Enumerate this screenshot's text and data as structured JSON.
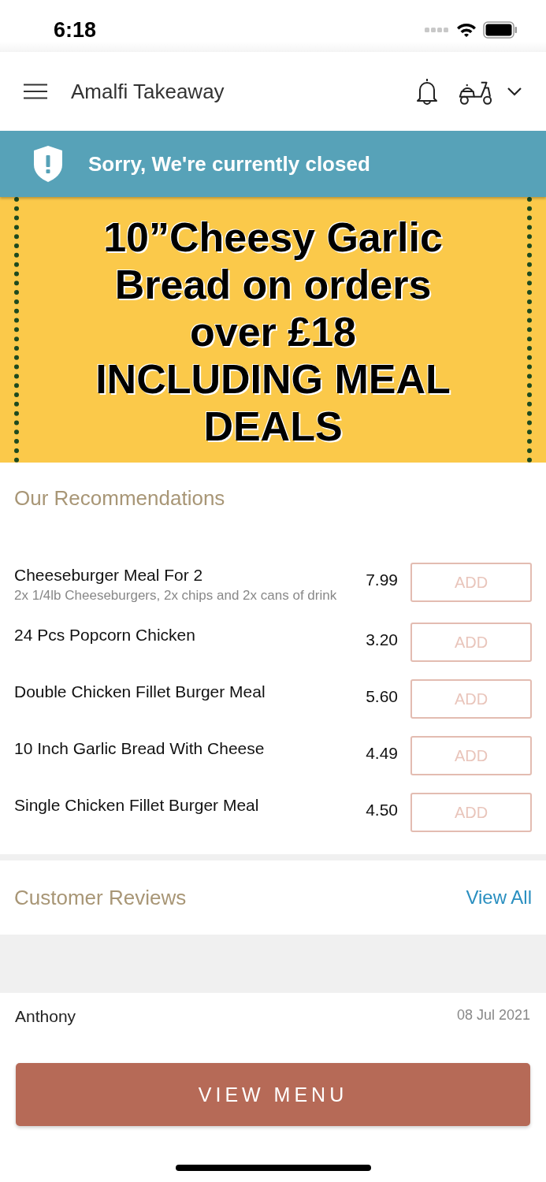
{
  "status_bar": {
    "time": "6:18"
  },
  "header": {
    "title": "Amalfi Takeaway"
  },
  "notice": {
    "text": "Sorry, We're currently closed"
  },
  "promo": {
    "lines": [
      "10”Cheesy Garlic",
      "Bread on orders",
      "over £18",
      "INCLUDING MEAL",
      "DEALS"
    ]
  },
  "recommendations": {
    "title": "Our Recommendations",
    "items": [
      {
        "name": "Cheeseburger Meal For 2",
        "description": "2x 1/4lb Cheeseburgers, 2x chips and 2x cans of drink",
        "price": "7.99",
        "button": "ADD"
      },
      {
        "name": "24 Pcs Popcorn Chicken",
        "price": "3.20",
        "button": "ADD"
      },
      {
        "name": "Double Chicken Fillet Burger Meal",
        "price": "5.60",
        "button": "ADD"
      },
      {
        "name": "10 Inch Garlic Bread With Cheese",
        "price": "4.49",
        "button": "ADD"
      },
      {
        "name": "Single Chicken Fillet Burger Meal",
        "price": "4.50",
        "button": "ADD"
      }
    ]
  },
  "reviews": {
    "title": "Customer Reviews",
    "link": "View All",
    "items": [
      {
        "author": "Anthony",
        "date": "08 Jul 2021"
      }
    ]
  },
  "footer_button": "VIEW MENU"
}
